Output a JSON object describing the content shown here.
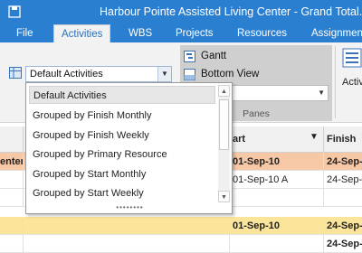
{
  "window": {
    "title": "Harbour Pointe Assisted Living Center - Grand Total.xe"
  },
  "tabs": [
    {
      "label": "File"
    },
    {
      "label": "Activities",
      "active": true
    },
    {
      "label": "WBS"
    },
    {
      "label": "Projects"
    },
    {
      "label": "Resources"
    },
    {
      "label": "Assignment"
    }
  ],
  "ribbon": {
    "layout_combo": {
      "value": "Default Activities"
    },
    "views": {
      "gantt_label": "Gantt",
      "bottom_view_label": "Bottom View",
      "group_label": "Panes"
    },
    "activities_button_label": "Activi"
  },
  "dropdown": {
    "options": [
      "Default Activities",
      "Grouped by Finish Monthly",
      "Grouped by Finish Weekly",
      "Grouped by Primary Resource",
      "Grouped by Start Monthly",
      "Grouped by Start Weekly"
    ],
    "selected_index": 0,
    "grip": "••••••••"
  },
  "grid": {
    "headers": {
      "start": "art",
      "finish": "Finish"
    },
    "rows": [
      {
        "left": "enter",
        "start": "01-Sep-10",
        "finish": "24-Sep-1",
        "color": "#f7c8a6"
      },
      {
        "left": "",
        "start": "01-Sep-10 A",
        "finish": "24-Sep-1",
        "color": "#ffffff"
      },
      {
        "left": "",
        "start": "",
        "finish": "",
        "color": "#ffffff"
      },
      {
        "left": "",
        "start": "01-Sep-10",
        "finish": "24-Sep-1",
        "color": "#fbe59a"
      },
      {
        "left": "",
        "start": "",
        "finish": "24-Sep-1",
        "color": "#ffffff"
      }
    ]
  },
  "colors": {
    "titlebar": "#2a7fd1",
    "ribbon": "#f2f2f2",
    "accent_row": "#f7c8a6",
    "summary_row": "#fbe59a"
  }
}
